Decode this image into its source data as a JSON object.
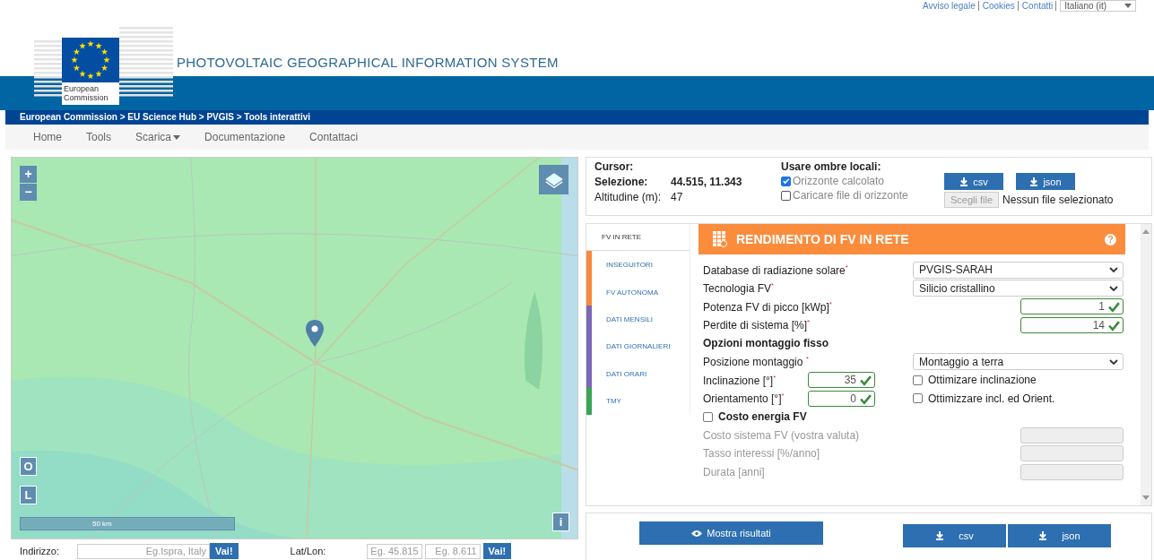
{
  "top_links": [
    "Avviso legale",
    "Cookies",
    "Contatti"
  ],
  "language": "Italiano (it)",
  "header": {
    "logo_caption": "European Commission",
    "site_title": "PHOTOVOLTAIC GEOGRAPHICAL INFORMATION SYSTEM"
  },
  "breadcrumb": "European Commission > EU Science Hub > PVGIS > Tools interattivi",
  "nav": [
    {
      "label": "Home",
      "dropdown": false
    },
    {
      "label": "Tools",
      "dropdown": false
    },
    {
      "label": "Scarica",
      "dropdown": true
    },
    {
      "label": "Documentazione",
      "dropdown": false
    },
    {
      "label": "Contattaci",
      "dropdown": false
    }
  ],
  "map": {
    "zoom_in": "+",
    "zoom_out": "−",
    "buttons": [
      "O",
      "L"
    ],
    "info": "i",
    "scale": "50 km"
  },
  "address": {
    "label": "Indirizzo:",
    "placeholder": "Eg.Ispra, Italy",
    "button": "Vai!"
  },
  "latlon": {
    "label": "Lat/Lon:",
    "lat_placeholder": "Eg. 45.815",
    "lon_placeholder": "Eg. 8.611",
    "button": "Vai!"
  },
  "info": {
    "cursor_label": "Cursor:",
    "selection_label": "Selezione:",
    "selection_value": "44.515, 11.343",
    "altitude_label": "Altitudine (m):",
    "altitude_value": "47"
  },
  "shadows": {
    "title": "Usare ombre locali:",
    "options": [
      {
        "label": "Orizzonte calcolato",
        "checked": true
      },
      {
        "label": "Caricare file di orizzonte",
        "checked": false
      }
    ]
  },
  "horizon_downloads": [
    "csv",
    "json"
  ],
  "file": {
    "button": "Scegli file",
    "status": "Nessun file selezionato"
  },
  "tabs": [
    {
      "label": "FV IN RETE",
      "selected": true,
      "color": "#ffffff"
    },
    {
      "label": "INSEGUITORI",
      "selected": false,
      "color": "#f68b3c"
    },
    {
      "label": "FV AUTONOMA",
      "selected": false,
      "color": "#f68b3c"
    },
    {
      "label": "DATI MENSILI",
      "selected": false,
      "color": "#7b68b5"
    },
    {
      "label": "DATI GIORNALIERI",
      "selected": false,
      "color": "#7b68b5"
    },
    {
      "label": "DATI ORARI",
      "selected": false,
      "color": "#7b68b5"
    },
    {
      "label": "TMY",
      "selected": false,
      "color": "#3aa655"
    }
  ],
  "panel": {
    "title": "RENDIMENTO DI FV IN RETE",
    "help": "?"
  },
  "fields": [
    {
      "kind": "select",
      "label": "Database di radiazione solare$^{*}$",
      "value": "PVGIS-SARAH"
    },
    {
      "kind": "select",
      "label": "Tecnologia FV$^{*}$",
      "value": "Silicio cristallino"
    },
    {
      "kind": "number",
      "label": "Potenza FV di picco [kWp]$^{*}$",
      "value": "1",
      "valid": true,
      "disabled": false
    },
    {
      "kind": "number",
      "label": "Perdite di sistema [%]$^{*}$",
      "value": "14",
      "valid": true,
      "disabled": false
    },
    {
      "kind": "heading",
      "label": "Opzioni montaggio fisso"
    },
    {
      "kind": "select",
      "label": "Posizione montaggio $^{*}$",
      "value": "Montaggio a terra"
    },
    {
      "kind": "angle",
      "label": "Inclinazione [°]$^{*}$",
      "value": "35",
      "valid": true,
      "option": {
        "label": "Ottimizare inclinazione",
        "checked": false
      }
    },
    {
      "kind": "angle",
      "label": "Orientamento [°]$^{*}$",
      "value": "0",
      "valid": true,
      "option": {
        "label": "Ottimizzare incl. ed Orient.",
        "checked": false
      }
    },
    {
      "kind": "toggle",
      "label": "Costo energia FV",
      "checked": false
    },
    {
      "kind": "number",
      "label": "Costo sistema FV (vostra valuta)",
      "valid": false,
      "disabled": true
    },
    {
      "kind": "number",
      "label": "Tasso interessi [%/anno]",
      "valid": false,
      "disabled": true
    },
    {
      "kind": "number",
      "label": "Durata [anni]",
      "valid": false,
      "disabled": true
    }
  ],
  "bottom": {
    "show_results": "Mostra risultati",
    "downloads": [
      "csv",
      "json"
    ]
  }
}
